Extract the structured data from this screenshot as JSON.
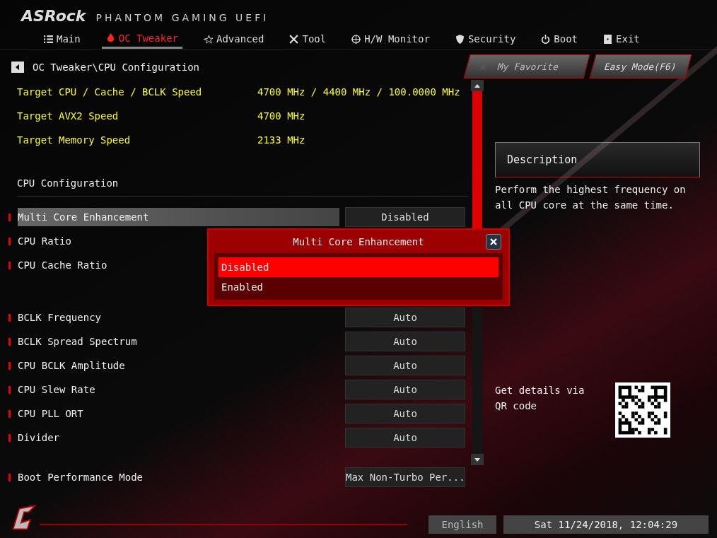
{
  "brand": {
    "name": "ASRock",
    "subtitle": "PHANTOM GAMING UEFI"
  },
  "tabs": [
    {
      "label": "Main",
      "selected": false
    },
    {
      "label": "OC Tweaker",
      "selected": true
    },
    {
      "label": "Advanced",
      "selected": false
    },
    {
      "label": "Tool",
      "selected": false
    },
    {
      "label": "H/W Monitor",
      "selected": false
    },
    {
      "label": "Security",
      "selected": false
    },
    {
      "label": "Boot",
      "selected": false
    },
    {
      "label": "Exit",
      "selected": false
    }
  ],
  "breadcrumb": "OC Tweaker\\CPU Configuration",
  "favorite_button": "My Favorite",
  "easy_mode_button": "Easy Mode(F6)",
  "info": [
    {
      "label": "Target CPU / Cache / BCLK Speed",
      "value": "4700 MHz / 4400 MHz / 100.0000 MHz"
    },
    {
      "label": "Target AVX2 Speed",
      "value": "4700 MHz"
    },
    {
      "label": "Target Memory Speed",
      "value": "2133 MHz"
    }
  ],
  "section_title": "CPU Configuration",
  "setting_groups": [
    [
      {
        "label": "Multi Core Enhancement",
        "value": "Disabled",
        "selected": true
      },
      {
        "label": "CPU Ratio",
        "selected": false
      },
      {
        "label": "CPU Cache Ratio",
        "selected": false
      }
    ],
    [
      {
        "label": "BCLK Frequency",
        "value": "Auto",
        "selected": false
      },
      {
        "label": "BCLK Spread Spectrum",
        "value": "Auto",
        "selected": false
      },
      {
        "label": "CPU BCLK Amplitude",
        "value": "Auto",
        "selected": false
      },
      {
        "label": "CPU Slew Rate",
        "value": "Auto",
        "selected": false
      },
      {
        "label": "CPU PLL ORT",
        "value": "Auto",
        "selected": false
      },
      {
        "label": "Divider",
        "value": "Auto",
        "selected": false
      }
    ],
    [
      {
        "label": "Boot Performance Mode",
        "value": "Max Non-Turbo Per...",
        "selected": false
      }
    ]
  ],
  "popup": {
    "title": "Multi Core Enhancement",
    "options": [
      {
        "label": "Disabled",
        "selected": true
      },
      {
        "label": "Enabled",
        "selected": false
      }
    ]
  },
  "description": {
    "title": "Description",
    "text": "Perform the highest frequency on all CPU core at the same time."
  },
  "qr_text": "Get details via QR code",
  "status_bar": {
    "language": "English",
    "datetime": "Sat 11/24/2018, 12:04:29"
  }
}
